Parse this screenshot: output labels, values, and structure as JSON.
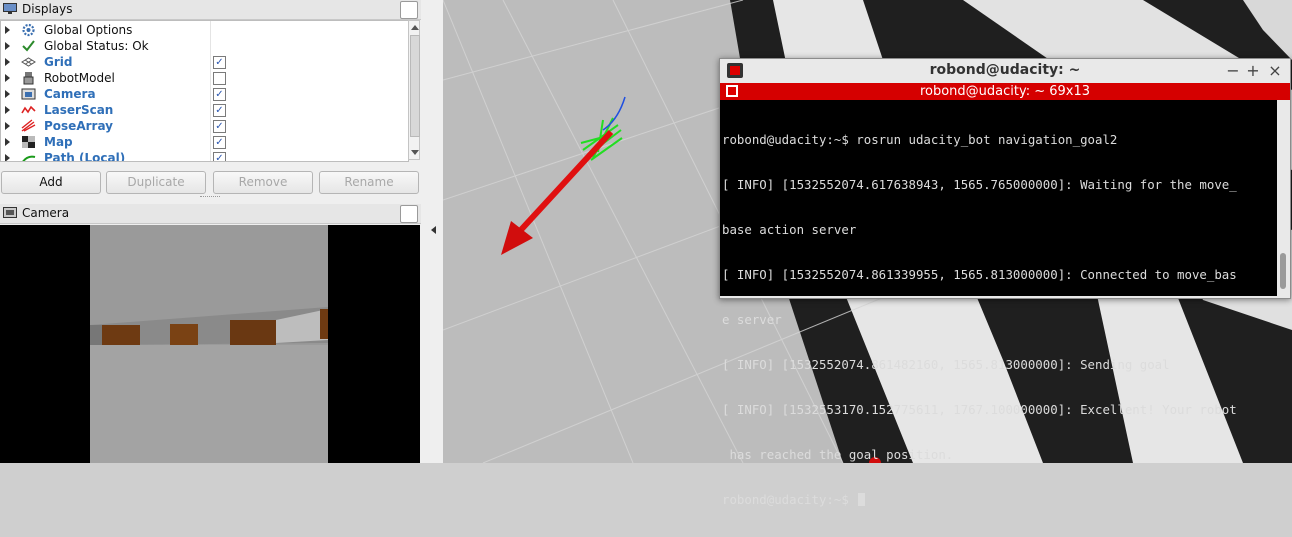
{
  "displays_panel": {
    "title": "Displays",
    "items": [
      {
        "label": "Global Options",
        "icon": "gear-icon",
        "style": "plain",
        "checked": null
      },
      {
        "label": "Global Status: Ok",
        "icon": "checkmark-icon",
        "style": "plain",
        "checked": null
      },
      {
        "label": "Grid",
        "icon": "grid-icon",
        "style": "blue",
        "checked": true
      },
      {
        "label": "RobotModel",
        "icon": "robot-icon",
        "style": "plain",
        "checked": false
      },
      {
        "label": "Camera",
        "icon": "camera-icon",
        "style": "blue",
        "checked": true
      },
      {
        "label": "LaserScan",
        "icon": "laserscan-icon",
        "style": "blue",
        "checked": true
      },
      {
        "label": "PoseArray",
        "icon": "posearray-icon",
        "style": "blue",
        "checked": true
      },
      {
        "label": "Map",
        "icon": "map-icon",
        "style": "blue",
        "checked": true
      },
      {
        "label": "Path (Local)",
        "icon": "path-icon",
        "style": "blue",
        "checked": true
      }
    ],
    "buttons": {
      "add": "Add",
      "duplicate": "Duplicate",
      "remove": "Remove",
      "rename": "Rename"
    }
  },
  "camera_panel": {
    "title": "Camera"
  },
  "terminal": {
    "window_title": "robond@udacity: ~",
    "tab_title": "robond@udacity: ~ 69x13",
    "lines": [
      "robond@udacity:~$ rosrun udacity_bot navigation_goal2",
      "[ INFO] [1532552074.617638943, 1565.765000000]: Waiting for the move_",
      "base action server",
      "[ INFO] [1532552074.861339955, 1565.813000000]: Connected to move_bas",
      "e server",
      "[ INFO] [1532552074.861482160, 1565.813000000]: Sending goal",
      "[ INFO] [1532553170.152775611, 1767.100000000]: Excellent! Your robot",
      " has reached the goal position."
    ],
    "prompt": "robond@udacity:~$ ",
    "buttons": {
      "minimize": "−",
      "maximize": "+",
      "close": "×"
    }
  },
  "colors": {
    "accent_red": "#d50000",
    "link_blue": "#2f6fb8",
    "pose_arrow_red": "#e01010",
    "pose_arrows_green": "#22dd22",
    "path_blue": "#1f4fe0"
  }
}
